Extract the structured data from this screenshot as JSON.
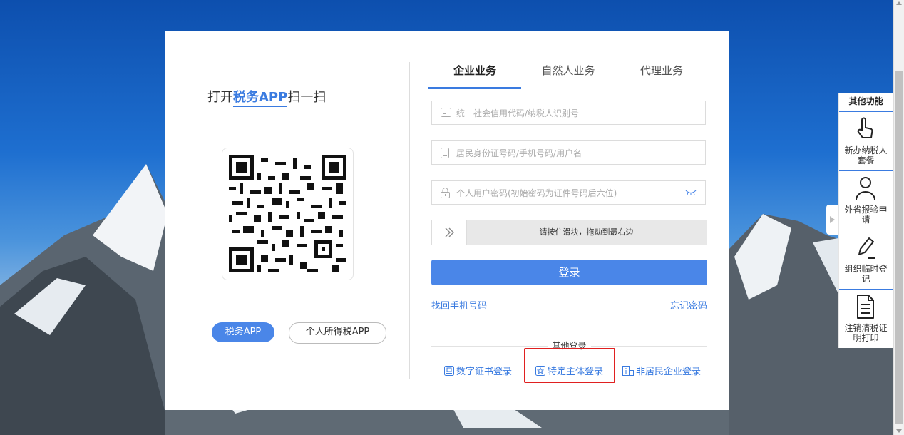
{
  "left_panel": {
    "title_prefix": "打开",
    "title_highlight": "税务APP",
    "title_suffix": "扫一扫",
    "app_buttons": [
      "税务APP",
      "个人所得税APP"
    ]
  },
  "tabs": [
    "企业业务",
    "自然人业务",
    "代理业务"
  ],
  "form": {
    "credit_code_placeholder": "统一社会信用代码/纳税人识别号",
    "id_placeholder": "居民身份证号码/手机号码/用户名",
    "password_placeholder": "个人用户密码(初始密码为证件号码后六位)",
    "slider_text": "请按住滑块，拖动到最右边",
    "login_label": "登录",
    "retrieve_phone": "找回手机号码",
    "forgot_password": "忘记密码"
  },
  "other_login": {
    "title": "其他登录",
    "options": [
      "数字证书登录",
      "特定主体登录",
      "非居民企业登录"
    ]
  },
  "side_panel": {
    "title": "其他功能",
    "items": [
      "新办纳税人套餐",
      "外省报验申请",
      "组织临时登记",
      "注销清税证明打印"
    ]
  },
  "colors": {
    "accent": "#4a86e8",
    "highlight_box": "#e02020"
  }
}
